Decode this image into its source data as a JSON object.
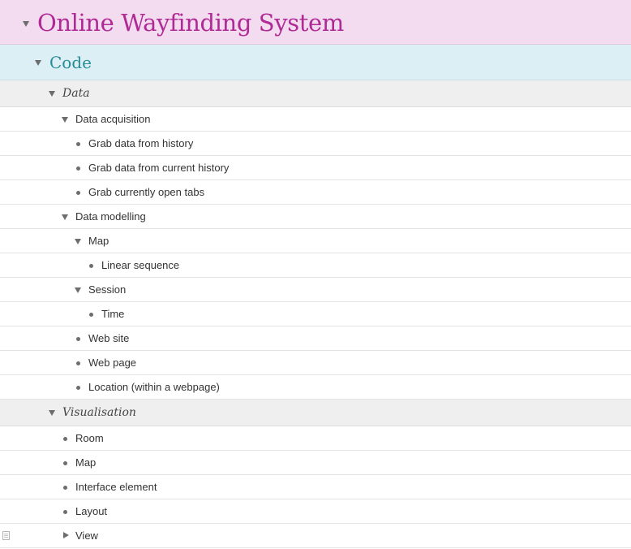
{
  "outline": {
    "title": "Online Wayfinding System",
    "code": "Code",
    "data_section": {
      "label": "Data",
      "acquisition": {
        "label": "Data acquisition",
        "items": [
          "Grab data from history",
          "Grab data from current history",
          "Grab currently open tabs"
        ]
      },
      "modelling": {
        "label": "Data modelling",
        "map": {
          "label": "Map",
          "items": [
            "Linear sequence"
          ]
        },
        "session": {
          "label": "Session",
          "items": [
            "Time"
          ]
        },
        "items": [
          "Web site",
          "Web page",
          "Location (within a webpage)"
        ]
      }
    },
    "visualisation": {
      "label": "Visualisation",
      "items": [
        "Room",
        "Map",
        "Interface element",
        "Layout"
      ],
      "view": "View"
    }
  },
  "colors": {
    "title": "#b02a96",
    "title_bg": "#f3dcef",
    "code": "#268c98",
    "code_bg": "#dbeff4",
    "section_bg": "#efefef"
  },
  "icons": [
    "disclosure-triangle-down-icon",
    "disclosure-triangle-right-icon",
    "bullet-icon",
    "document-icon"
  ]
}
